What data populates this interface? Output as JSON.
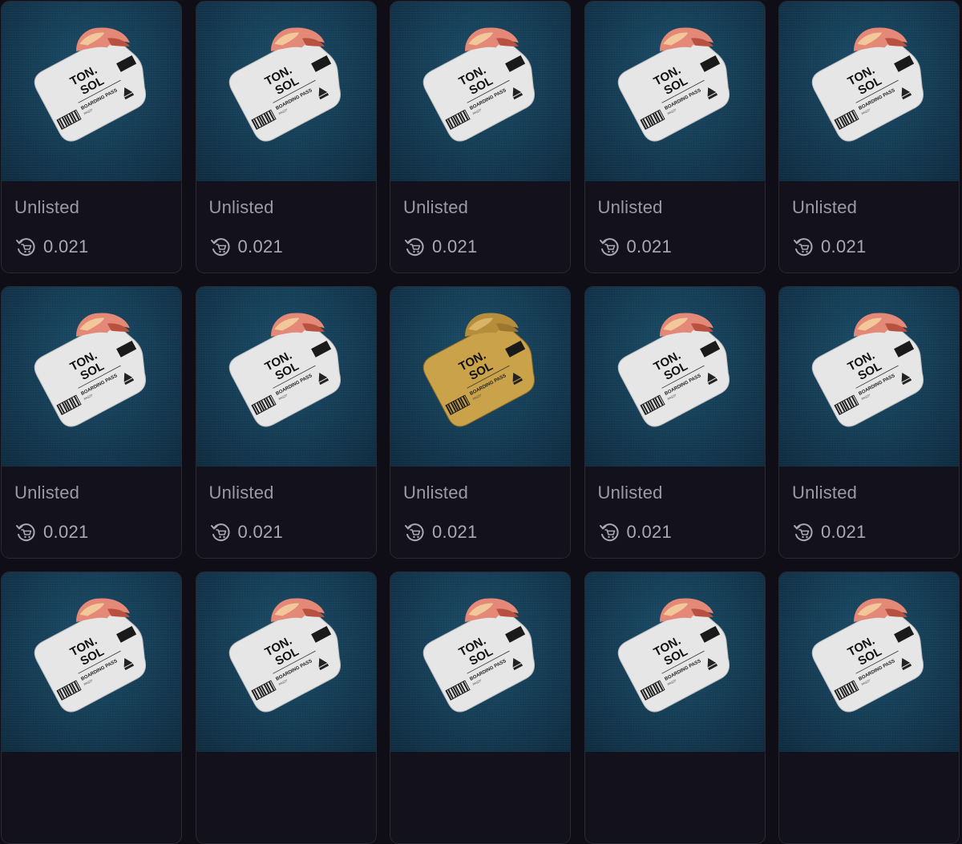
{
  "cards": [
    {
      "status": "Unlisted",
      "price": "0.021",
      "variant": "silver",
      "ticket_title": "TON.\nSOL",
      "ticket_sub": "BOARDING PASS",
      "ticket_tag": "#001"
    },
    {
      "status": "Unlisted",
      "price": "0.021",
      "variant": "silver",
      "ticket_title": "TON.\nSOL",
      "ticket_sub": "BOARDING PASS",
      "ticket_tag": "#001"
    },
    {
      "status": "Unlisted",
      "price": "0.021",
      "variant": "silver",
      "ticket_title": "TON.\nSOL",
      "ticket_sub": "BOARDING PASS",
      "ticket_tag": "#001"
    },
    {
      "status": "Unlisted",
      "price": "0.021",
      "variant": "silver",
      "ticket_title": "TON.\nSOL",
      "ticket_sub": "BOARDING PASS",
      "ticket_tag": "#001"
    },
    {
      "status": "Unlisted",
      "price": "0.021",
      "variant": "silver",
      "ticket_title": "TON.\nSOL",
      "ticket_sub": "BOARDING PASS",
      "ticket_tag": "#001"
    },
    {
      "status": "Unlisted",
      "price": "0.021",
      "variant": "silver",
      "ticket_title": "TON.\nSOL",
      "ticket_sub": "BOARDING PASS",
      "ticket_tag": "#001"
    },
    {
      "status": "Unlisted",
      "price": "0.021",
      "variant": "silver",
      "ticket_title": "TON.\nSOL",
      "ticket_sub": "BOARDING PASS",
      "ticket_tag": "#001"
    },
    {
      "status": "Unlisted",
      "price": "0.021",
      "variant": "gold",
      "ticket_title": "TON.\nSOL",
      "ticket_sub": "BOARDING PASS",
      "ticket_tag": "#001"
    },
    {
      "status": "Unlisted",
      "price": "0.021",
      "variant": "silver",
      "ticket_title": "TON.\nSOL",
      "ticket_sub": "BOARDING PASS",
      "ticket_tag": "#001"
    },
    {
      "status": "Unlisted",
      "price": "0.021",
      "variant": "silver",
      "ticket_title": "TON.\nSOL",
      "ticket_sub": "BOARDING PASS",
      "ticket_tag": "#001"
    },
    {
      "status": "",
      "price": "",
      "variant": "silver",
      "ticket_title": "TON.\nSOL",
      "ticket_sub": "BOARDING PASS",
      "ticket_tag": "#001"
    },
    {
      "status": "",
      "price": "",
      "variant": "silver",
      "ticket_title": "TON.\nSOL",
      "ticket_sub": "BOARDING PASS",
      "ticket_tag": "#001"
    },
    {
      "status": "",
      "price": "",
      "variant": "silver",
      "ticket_title": "TON.\nSOL",
      "ticket_sub": "BOARDING PASS",
      "ticket_tag": "#001"
    },
    {
      "status": "",
      "price": "",
      "variant": "silver",
      "ticket_title": "TON.\nSOL",
      "ticket_sub": "BOARDING PASS",
      "ticket_tag": "#001"
    },
    {
      "status": "",
      "price": "",
      "variant": "silver",
      "ticket_title": "TON.\nSOL",
      "ticket_sub": "BOARDING PASS",
      "ticket_tag": "#001"
    }
  ],
  "icons": {
    "price_icon": "cart-cycle-icon",
    "nft_image": "boarding-pass-ticket-icon"
  },
  "colors": {
    "background": "#0f0e17",
    "card_bg": "#13121c",
    "card_border": "#2a2a36",
    "image_bg": "#163f58",
    "status_text": "#9b9aa6",
    "price_text": "#a9a8b4",
    "ticket_silver": "#e6e6e6",
    "ticket_gold": "#c9a24a",
    "ticket_flame": "#e48877"
  }
}
